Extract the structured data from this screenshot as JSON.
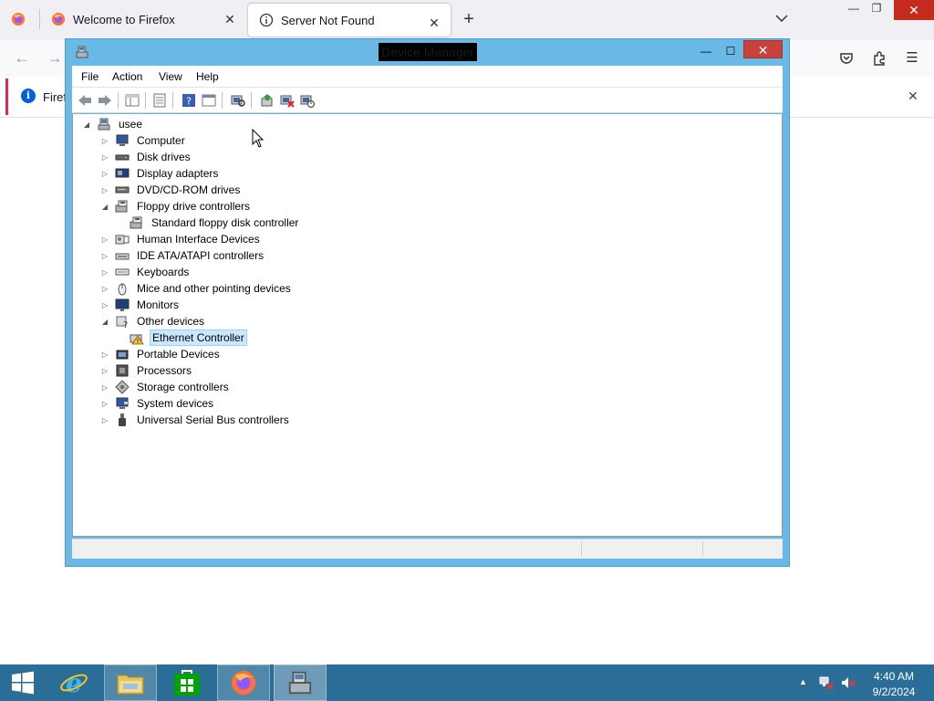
{
  "browser": {
    "tabs": [
      {
        "label": ""
      },
      {
        "label": "Welcome to Firefox"
      },
      {
        "label": "Server Not Found"
      }
    ],
    "infobar_text": "Firefo"
  },
  "device_manager": {
    "title": "Device Manager",
    "menu": [
      "File",
      "Action",
      "View",
      "Help"
    ],
    "tree": {
      "root": "usee",
      "items": [
        {
          "label": "Computer",
          "expanded": false,
          "icon": "computer-icon"
        },
        {
          "label": "Disk drives",
          "expanded": false,
          "icon": "disk-drive-icon"
        },
        {
          "label": "Display adapters",
          "expanded": false,
          "icon": "display-adapter-icon"
        },
        {
          "label": "DVD/CD-ROM drives",
          "expanded": false,
          "icon": "dvd-drive-icon"
        },
        {
          "label": "Floppy drive controllers",
          "expanded": true,
          "icon": "floppy-controller-icon",
          "children": [
            {
              "label": "Standard floppy disk controller",
              "icon": "floppy-controller-icon"
            }
          ]
        },
        {
          "label": "Human Interface Devices",
          "expanded": false,
          "icon": "hid-icon"
        },
        {
          "label": "IDE ATA/ATAPI controllers",
          "expanded": false,
          "icon": "ide-controller-icon"
        },
        {
          "label": "Keyboards",
          "expanded": false,
          "icon": "keyboard-icon"
        },
        {
          "label": "Mice and other pointing devices",
          "expanded": false,
          "icon": "mouse-icon"
        },
        {
          "label": "Monitors",
          "expanded": false,
          "icon": "monitor-icon"
        },
        {
          "label": "Other devices",
          "expanded": true,
          "icon": "other-devices-icon",
          "children": [
            {
              "label": "Ethernet Controller",
              "icon": "warning-device-icon",
              "selected": true
            }
          ]
        },
        {
          "label": "Portable Devices",
          "expanded": false,
          "icon": "portable-device-icon"
        },
        {
          "label": "Processors",
          "expanded": false,
          "icon": "processor-icon"
        },
        {
          "label": "Storage controllers",
          "expanded": false,
          "icon": "storage-controller-icon"
        },
        {
          "label": "System devices",
          "expanded": false,
          "icon": "system-device-icon"
        },
        {
          "label": "Universal Serial Bus controllers",
          "expanded": false,
          "icon": "usb-icon"
        }
      ]
    }
  },
  "taskbar": {
    "apps": [
      "internet-explorer-icon",
      "file-explorer-icon",
      "store-icon",
      "firefox-icon",
      "device-manager-icon"
    ],
    "clock_time": "4:40 AM",
    "clock_date": "9/2/2024"
  },
  "colors": {
    "window_frame": "#6ab8e6",
    "taskbar": "#2a6e97",
    "close_button": "#c7423a",
    "selection": "#cce8ff"
  }
}
